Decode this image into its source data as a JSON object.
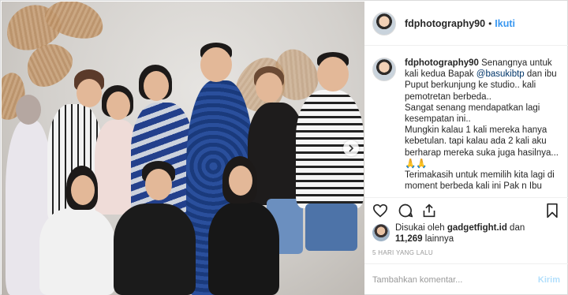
{
  "header": {
    "username": "fdphotography90",
    "separator": "•",
    "follow_label": "Ikuti"
  },
  "caption": {
    "username": "fdphotography90",
    "part1": "Senangnya untuk kali kedua Bapak ",
    "mention": "@basukibtp",
    "part2": " dan ibu Puput berkunjung ke studio.. kali pemotretan berbeda..",
    "line2": "Sangat senang mendapatkan lagi kesempatan ini..",
    "line3": "Mungkin kalau 1 kali mereka hanya kebetulan. tapi kalau ada 2 kali aku berharap mereka suka juga hasilnya...",
    "line4": "🙏🙏",
    "line5": "Terimakasih untuk memilih kita lagi di moment berbeda kali ini Pak n Ibu"
  },
  "likes": {
    "prefix": "Disukai oleh ",
    "user": "gadgetfight.id",
    "middle": " dan",
    "count": "11,269",
    "suffix": " lainnya"
  },
  "timestamp": "5 HARI YANG LALU",
  "comment_box": {
    "placeholder": "Tambahkan komentar...",
    "send_label": "Kirim"
  },
  "icons": {
    "like": "heart-icon",
    "comment": "comment-icon",
    "share": "share-icon",
    "save": "bookmark-icon",
    "next": "chevron-right-icon"
  },
  "colors": {
    "link": "#3897f0",
    "mention": "#003569",
    "send_disabled": "#b2dffc"
  }
}
